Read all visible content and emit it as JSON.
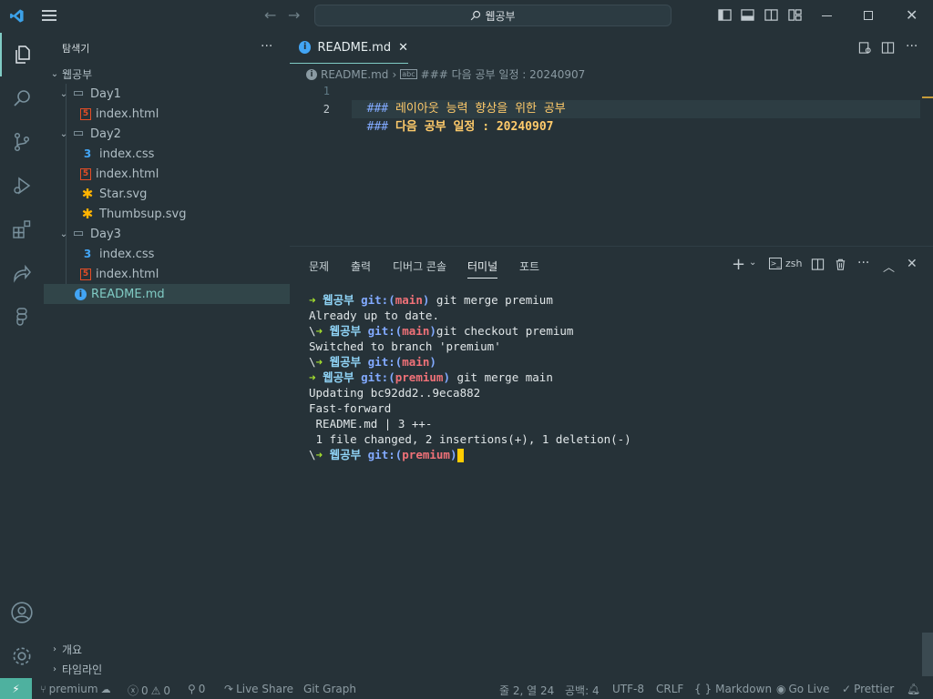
{
  "titlebar": {
    "search_text": "웹공부"
  },
  "activity_bar": {
    "items": [
      "files-icon",
      "search-icon",
      "source-control-icon",
      "run-debug-icon",
      "extensions-icon",
      "live-share-icon",
      "figma-icon"
    ],
    "bottom": [
      "account-icon",
      "settings-icon"
    ]
  },
  "sidebar": {
    "title": "탐색기",
    "more": "···",
    "root": "웹공부",
    "tree": [
      {
        "label": "Day1",
        "type": "folder"
      },
      {
        "label": "index.html",
        "type": "html"
      },
      {
        "label": "Day2",
        "type": "folder"
      },
      {
        "label": "index.css",
        "type": "css"
      },
      {
        "label": "index.html",
        "type": "html"
      },
      {
        "label": "Star.svg",
        "type": "svg"
      },
      {
        "label": "Thumbsup.svg",
        "type": "svg"
      },
      {
        "label": "Day3",
        "type": "folder"
      },
      {
        "label": "index.css",
        "type": "css"
      },
      {
        "label": "index.html",
        "type": "html"
      },
      {
        "label": "README.md",
        "type": "md"
      }
    ],
    "outline": "개요",
    "timeline": "타임라인"
  },
  "editor": {
    "tab_label": "README.md",
    "breadcrumb_file": "README.md",
    "breadcrumb_symbol": "### 다음 공부 일정 : 20240907",
    "lines": [
      {
        "num": "1",
        "hash": "###",
        "text": " 레이아웃 능력 향상을 위한 공부"
      },
      {
        "num": "2",
        "hash": "###",
        "text": " 다음 공부 일정 : 20240907"
      }
    ]
  },
  "panel": {
    "tabs": [
      "문제",
      "출력",
      "디버그 콘솔",
      "터미널",
      "포트"
    ],
    "active_tab": "터미널",
    "shell": "zsh",
    "terminal": {
      "l1_dir": "웹공부",
      "l1_branch": "main",
      "l1_cmd": " git merge premium",
      "l2": "Already up to date.",
      "l3_dir": "웹공부",
      "l3_branch": "main",
      "l3_cmd": "git checkout premium",
      "l4": "Switched to branch 'premium'",
      "l5_dir": "웹공부",
      "l5_branch": "main",
      "l6_dir": "웹공부",
      "l6_branch": "premium",
      "l6_cmd": " git merge main",
      "l7": "Updating bc92dd2..9eca882",
      "l8": "Fast-forward",
      "l9": " README.md | 3 ++-",
      "l10": " 1 file changed, 2 insertions(+), 1 deletion(-)",
      "l11_dir": "웹공부",
      "l11_branch": "premium",
      "git": "git:",
      "arrow": "➜"
    }
  },
  "statusbar": {
    "branch": "premium",
    "errors": "0",
    "warnings": "0",
    "ports": "0",
    "live_share": "Live Share",
    "git_graph": "Git Graph",
    "position": "줄 2, 열 24",
    "spaces": "공백: 4",
    "encoding": "UTF-8",
    "eol": "CRLF",
    "language": "Markdown",
    "go_live": "Go Live",
    "prettier": "Prettier"
  },
  "colors": {
    "background": "#263238",
    "accent": "#80cbc4",
    "remote": "#4eb19f",
    "html_icon": "#e44d26",
    "css_icon": "#42a5f5",
    "svg_icon": "#ffb300",
    "md_icon": "#42a5f5",
    "md_heading": "#ffcb6b"
  }
}
